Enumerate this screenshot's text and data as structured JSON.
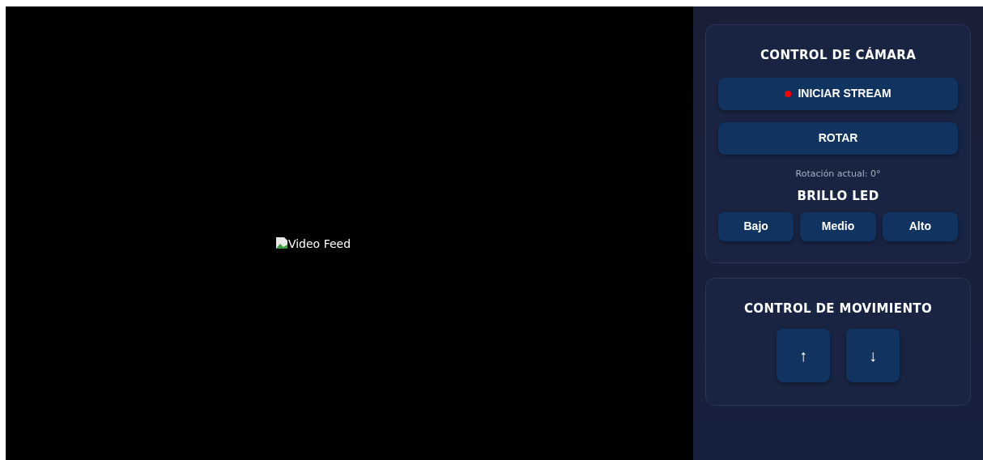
{
  "video": {
    "alt_text": "Video Feed"
  },
  "camera_panel": {
    "title": "CONTROL DE CÁMARA",
    "stream_button": {
      "label": "INICIAR STREAM",
      "streaming": false
    },
    "rotate_button": {
      "label": "ROTAR"
    },
    "rotation_status": "Rotación actual: 0°",
    "led_title": "BRILLO LED",
    "led_buttons": [
      "Bajo",
      "Medio",
      "Alto"
    ]
  },
  "movement_panel": {
    "title": "CONTROL DE MOVIMIENTO",
    "buttons": [
      "↑",
      "↓"
    ]
  }
}
